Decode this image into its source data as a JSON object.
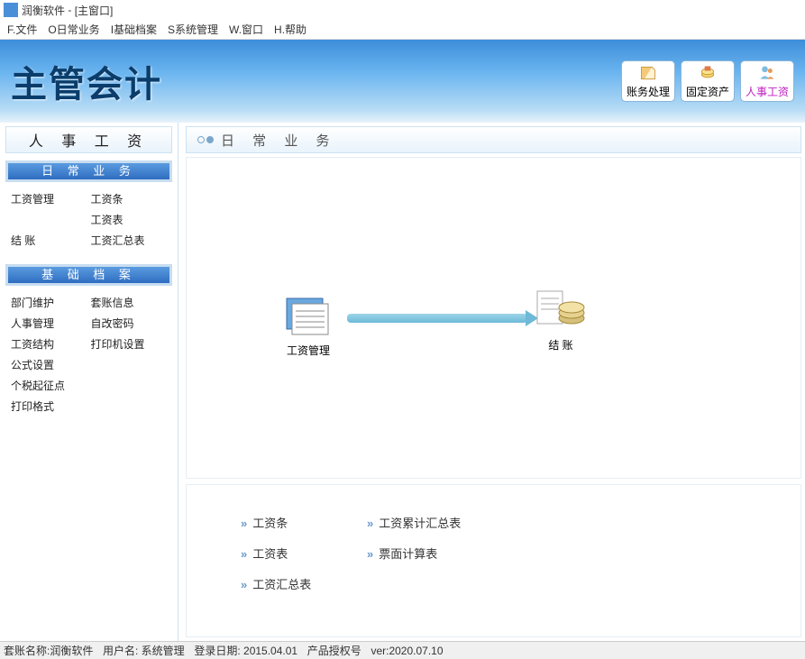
{
  "titlebar": {
    "app": "润衡软件",
    "window": "[主窗口]"
  },
  "menu": [
    "F.文件",
    "O日常业务",
    "I基础档案",
    "S系统管理",
    "W.窗口",
    "H.帮助"
  ],
  "logo": "主管会计",
  "toolbar": [
    {
      "label": "账务处理",
      "active": false
    },
    {
      "label": "固定资产",
      "active": false
    },
    {
      "label": "人事工资",
      "active": true
    }
  ],
  "sidebar": {
    "title": "人 事 工 资",
    "sections": [
      {
        "header": "日 常 业 务",
        "items": [
          "工资管理",
          "工资条",
          "",
          "工资表",
          "结 账",
          "工资汇总表"
        ]
      },
      {
        "header": "基 础 档 案",
        "items": [
          "部门维护",
          "套账信息",
          "人事管理",
          "自改密码",
          "工资结构",
          "打印机设置",
          "公式设置",
          "",
          "个税起征点",
          "",
          "打印格式",
          ""
        ]
      }
    ]
  },
  "main": {
    "title": "日 常 业 务",
    "nodes": {
      "left": "工资管理",
      "right": "结 账"
    },
    "links": [
      "工资条",
      "工资累计汇总表",
      "工资表",
      "票面计算表",
      "工资汇总表"
    ]
  },
  "status": {
    "s1": "套账名称:润衡软件",
    "s2": "用户名: 系统管理",
    "s3": "登录日期: 2015.04.01",
    "s4": "产品授权号",
    "s5": "ver:2020.07.10"
  }
}
